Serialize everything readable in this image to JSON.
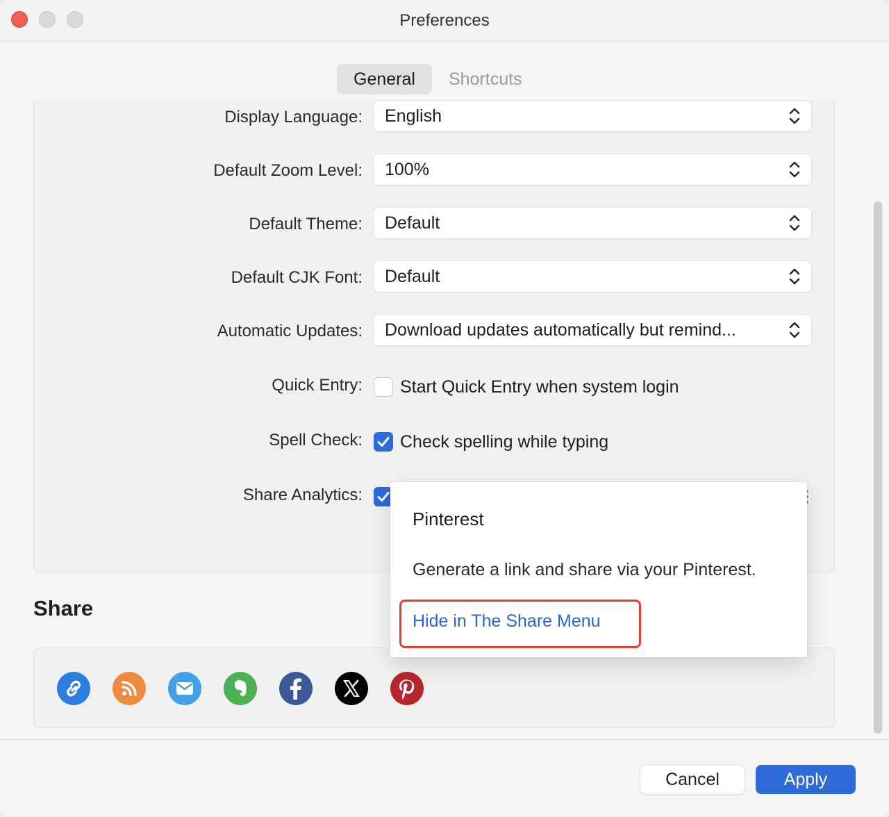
{
  "window": {
    "title": "Preferences"
  },
  "tabs": [
    {
      "label": "General",
      "active": true
    },
    {
      "label": "Shortcuts",
      "active": false
    }
  ],
  "settings": {
    "display_language": {
      "label": "Display Language:",
      "value": "English"
    },
    "zoom_level": {
      "label": "Default Zoom Level:",
      "value": "100%"
    },
    "theme": {
      "label": "Default Theme:",
      "value": "Default"
    },
    "cjk_font": {
      "label": "Default CJK Font:",
      "value": "Default"
    },
    "updates": {
      "label": "Automatic Updates:",
      "value": "Download updates automatically but remind..."
    },
    "quick_entry": {
      "label": "Quick Entry:",
      "checkbox_label": "Start Quick Entry when system login",
      "checked": false
    },
    "spell_check": {
      "label": "Spell Check:",
      "checkbox_label": "Check spelling while typing",
      "checked": true
    },
    "share_analytics": {
      "label": "Share Analytics:",
      "checked": true
    }
  },
  "share": {
    "title": "Share",
    "icons": [
      {
        "name": "link-icon",
        "color": "#2b7de1"
      },
      {
        "name": "rss-icon",
        "color": "#ee8b3f"
      },
      {
        "name": "mail-icon",
        "color": "#41a1e8"
      },
      {
        "name": "evernote-icon",
        "color": "#4cb152"
      },
      {
        "name": "facebook-icon",
        "color": "#3b5998"
      },
      {
        "name": "x-icon",
        "color": "#000000"
      },
      {
        "name": "pinterest-icon",
        "color": "#b7252d"
      }
    ]
  },
  "popover": {
    "title": "Pinterest",
    "description": "Generate a link and share via your Pinterest.",
    "action": "Hide in The Share Menu"
  },
  "footer": {
    "cancel_label": "Cancel",
    "apply_label": "Apply"
  },
  "colors": {
    "accent": "#2d6bd9",
    "highlight": "#e2402f",
    "link": "#2b66d4"
  }
}
